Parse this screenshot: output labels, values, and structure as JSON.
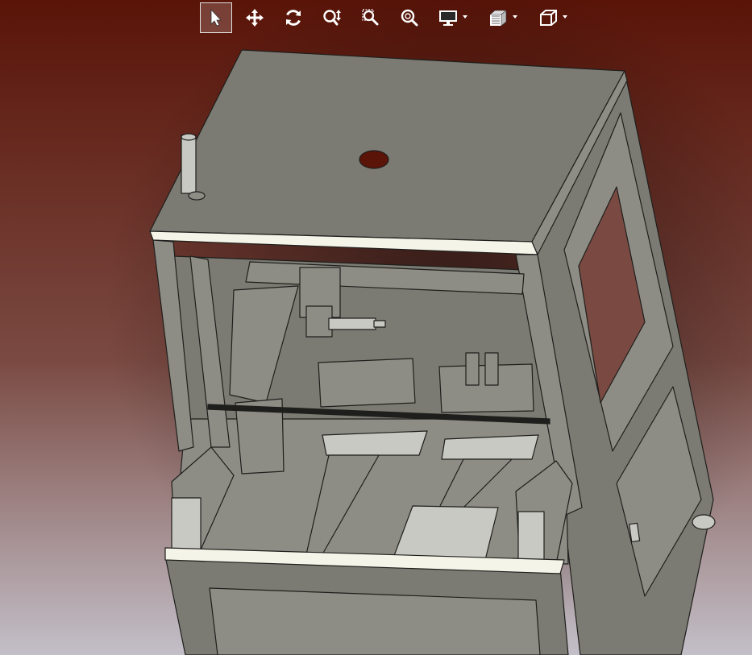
{
  "viewer": {
    "background": {
      "top_color": "#5a1408",
      "mid_color": "#7a4a42",
      "bottom_color": "#c3bfc8"
    },
    "active_tool": "select",
    "toolbar": [
      {
        "id": "select",
        "icon": "arrow-pointer-icon",
        "has_menu": false
      },
      {
        "id": "pan",
        "icon": "move-arrows-icon",
        "has_menu": false
      },
      {
        "id": "rotate",
        "icon": "rotate-icon",
        "has_menu": false
      },
      {
        "id": "zoom-up-down",
        "icon": "zoom-updown-icon",
        "has_menu": false
      },
      {
        "id": "zoom-window",
        "icon": "zoom-window-icon",
        "has_menu": false
      },
      {
        "id": "zoom-fit",
        "icon": "zoom-fit-icon",
        "has_menu": false
      },
      {
        "id": "display-mode",
        "icon": "monitor-icon",
        "has_menu": true
      },
      {
        "id": "section-view",
        "icon": "section-view-icon",
        "has_menu": true
      },
      {
        "id": "view-orientation",
        "icon": "cube-view-icon",
        "has_menu": true
      }
    ]
  },
  "model": {
    "body_color": "#7c7b73",
    "frame_color": "#8e8d85",
    "edge_color": "#1e1e1c",
    "trim_color": "#f4f4e8",
    "metal_color": "#c9c9c3"
  }
}
